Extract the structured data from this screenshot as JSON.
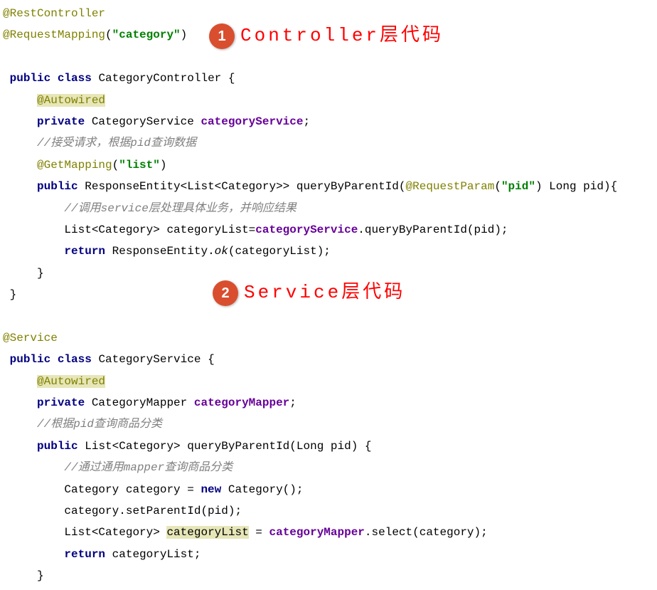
{
  "badges": {
    "b1": {
      "num": "1",
      "label": "Controller层代码"
    },
    "b2": {
      "num": "2",
      "label": "Service层代码"
    }
  },
  "code": {
    "a_rest": "@RestController",
    "a_reqmap_pre": "@RequestMapping",
    "a_reqmap_paren_open": "(",
    "a_reqmap_str": "\"category\"",
    "a_reqmap_paren_close": ")",
    "cls1_public": "public class ",
    "cls1_name": "CategoryController {",
    "autowired": "@Autowired",
    "priv1_kw": "private ",
    "priv1_type": "CategoryService ",
    "priv1_field": "categoryService",
    "priv1_semi": ";",
    "cmt1": "//接受请求，根据pid查询数据",
    "getmap_pre": "@GetMapping",
    "getmap_paren_open": "(",
    "getmap_str": "\"list\"",
    "getmap_paren_close": ")",
    "m1_public": "public ",
    "m1_sig": "ResponseEntity<List<Category>> queryByParentId(",
    "m1_reqparam": "@RequestParam",
    "m1_reqparam_paren_open": "(",
    "m1_reqparam_str": "\"pid\"",
    "m1_reqparam_paren_close": ") ",
    "m1_sig2": "Long pid){",
    "cmt2": "//调用service层处理具体业务，并响应结果",
    "m1_body1_a": "List<Category> categoryList=",
    "m1_body1_field": "categoryService",
    "m1_body1_b": ".queryByParentId(pid);",
    "m1_ret_kw": "return ",
    "m1_ret_a": "ResponseEntity.",
    "m1_ret_ok": "ok",
    "m1_ret_b": "(categoryList);",
    "close_brace": "}",
    "a_service": "@Service",
    "cls2_public": "public class ",
    "cls2_name": "CategoryService {",
    "priv2_kw": "private ",
    "priv2_type": "CategoryMapper ",
    "priv2_field": "categoryMapper",
    "priv2_semi": ";",
    "cmt3": "//根据pid查询商品分类",
    "m2_public": "public ",
    "m2_sig": "List<Category> queryByParentId(Long pid) {",
    "cmt4": "//通过通用mapper查询商品分类",
    "m2_body1_a": "Category category = ",
    "m2_body1_new": "new ",
    "m2_body1_b": "Category();",
    "m2_body2": "category.setParentId(pid);",
    "m2_body3_a": "List<Category> ",
    "m2_body3_hl": "categoryList",
    "m2_body3_b": " = ",
    "m2_body3_field": "categoryMapper",
    "m2_body3_c": ".select(category);",
    "m2_ret_kw": "return ",
    "m2_ret_b": "categoryList;"
  }
}
